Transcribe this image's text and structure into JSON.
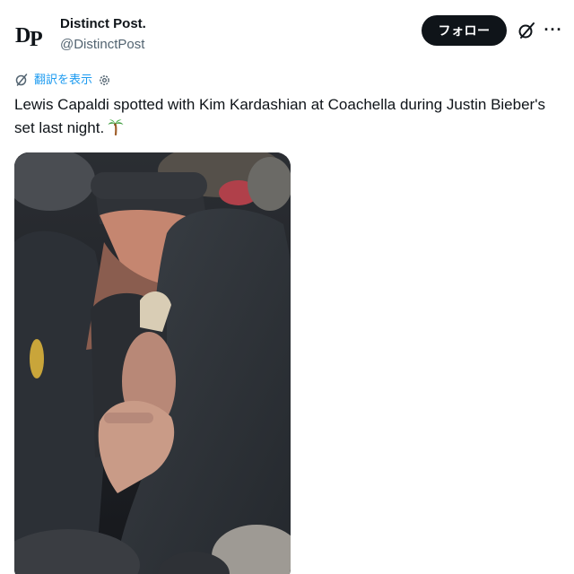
{
  "header": {
    "logo_text": "DP",
    "display_name": "Distinct Post.",
    "handle": "@DistinctPost",
    "follow_label": "フォロー",
    "more_label": "···"
  },
  "translate": {
    "label": "翻訳を表示"
  },
  "tweet": {
    "text": "Lewis Capaldi spotted with Kim Kardashian at Coachella during Justin Bieber's set last night.",
    "emoji": "palm-tree"
  },
  "media": {
    "type": "photo",
    "subject": "crowd-at-concert"
  },
  "colors": {
    "text": "#0f1419",
    "secondary": "#536471",
    "link": "#1d9bf0",
    "follow_bg": "#0f1419",
    "follow_text": "#ffffff"
  }
}
